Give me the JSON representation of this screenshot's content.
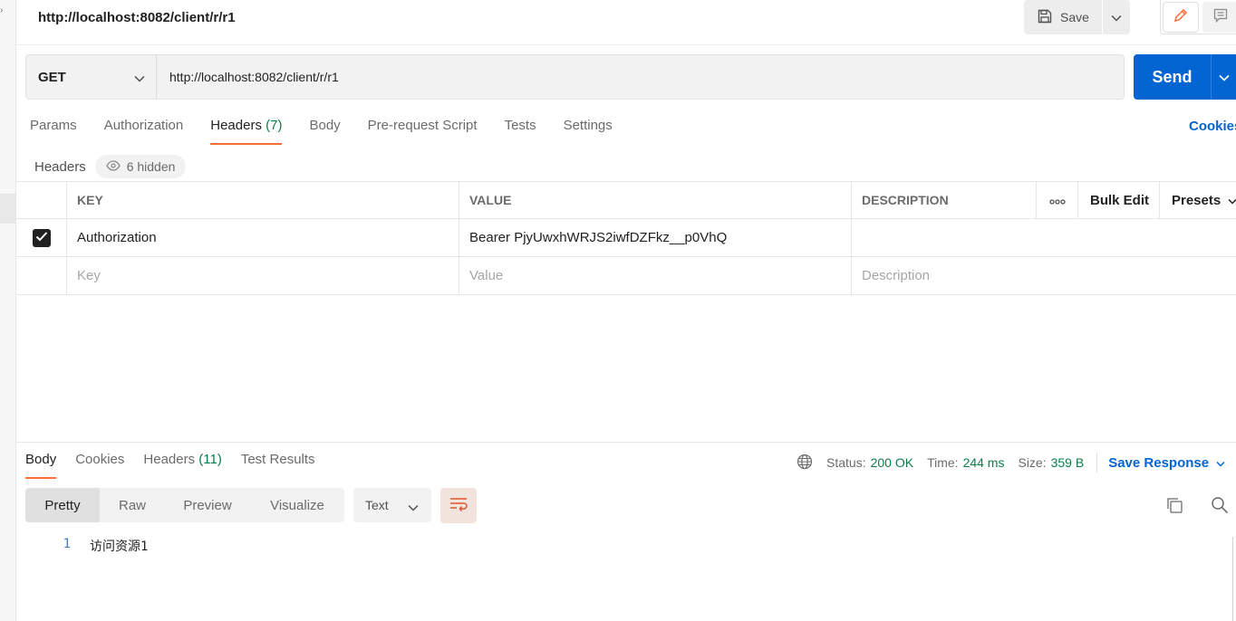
{
  "top_bar": {
    "request_name": "http://localhost:8082/client/r/r1",
    "save_label": "Save",
    "icons": [
      "save-icon",
      "chevron-down-icon",
      "edit-pencil-icon",
      "comment-icon"
    ]
  },
  "url_bar": {
    "method": "GET",
    "url": "http://localhost:8082/client/r/r1",
    "send_label": "Send"
  },
  "request_tabs": {
    "params": "Params",
    "authorization": "Authorization",
    "headers": "Headers",
    "headers_count": "(7)",
    "body": "Body",
    "pre_request": "Pre-request Script",
    "tests": "Tests",
    "settings": "Settings",
    "active": "Headers"
  },
  "cookies_link": "Cookies",
  "headers_section": {
    "label": "Headers",
    "hidden_label": "6 hidden"
  },
  "headers_table": {
    "columns": {
      "key": "KEY",
      "value": "VALUE",
      "description": "DESCRIPTION",
      "bulk_edit": "Bulk Edit",
      "presets": "Presets"
    },
    "rows": [
      {
        "checked": true,
        "key": "Authorization",
        "value": "Bearer  PjyUwxhWRJS2iwfDZFkz__p0VhQ",
        "description": ""
      }
    ],
    "new_row": {
      "key_placeholder": "Key",
      "value_placeholder": "Value",
      "description_placeholder": "Description"
    }
  },
  "response": {
    "tabs": {
      "body": "Body",
      "cookies": "Cookies",
      "headers": "Headers",
      "headers_count": "(11)",
      "test_results": "Test Results",
      "active": "Body"
    },
    "status_label": "Status:",
    "status_value": "200 OK",
    "time_label": "Time:",
    "time_value": "244 ms",
    "size_label": "Size:",
    "size_value": "359 B",
    "save_response": "Save Response",
    "view_modes": [
      "Pretty",
      "Raw",
      "Preview",
      "Visualize"
    ],
    "active_view": "Pretty",
    "format": "Text",
    "lines": [
      {
        "no": "1",
        "text": "访问资源1"
      }
    ]
  },
  "colors": {
    "accent_orange": "#ff6c37",
    "send_blue": "#0265d2",
    "status_green": "#0a7e4a"
  }
}
